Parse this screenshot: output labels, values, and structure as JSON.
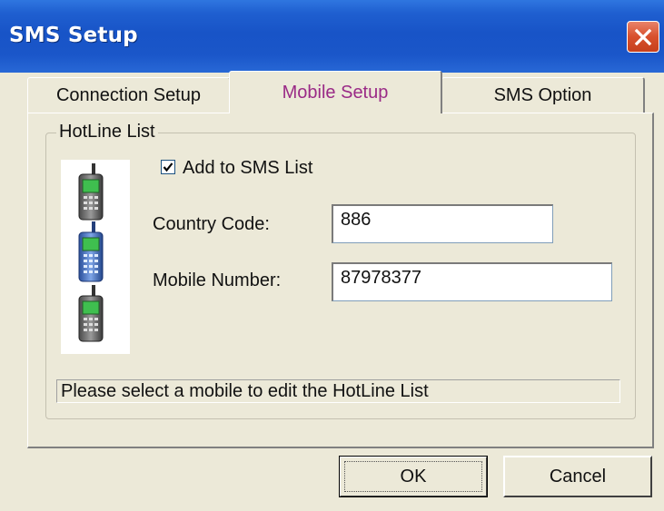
{
  "window": {
    "title": "SMS Setup"
  },
  "tabs": [
    {
      "label": "Connection Setup",
      "active": false
    },
    {
      "label": "Mobile Setup",
      "active": true
    },
    {
      "label": "SMS Option",
      "active": false
    }
  ],
  "hotline": {
    "group_label": "HotLine List",
    "phones": [
      "mobile-phone-icon",
      "mobile-phone-icon",
      "mobile-phone-icon"
    ],
    "add_to_sms_list": {
      "label": "Add to SMS List",
      "checked": true
    },
    "country_code": {
      "label": "Country Code:",
      "value": "886"
    },
    "mobile_number": {
      "label": "Mobile Number:",
      "value": "87978377"
    },
    "status": "Please select a mobile to edit the HotLine List"
  },
  "buttons": {
    "ok": "OK",
    "cancel": "Cancel"
  },
  "colors": {
    "titlebar": "#1854c7",
    "close_button": "#d8502d",
    "active_tab_text": "#9a2a86",
    "dialog_background": "#ece9d8"
  }
}
